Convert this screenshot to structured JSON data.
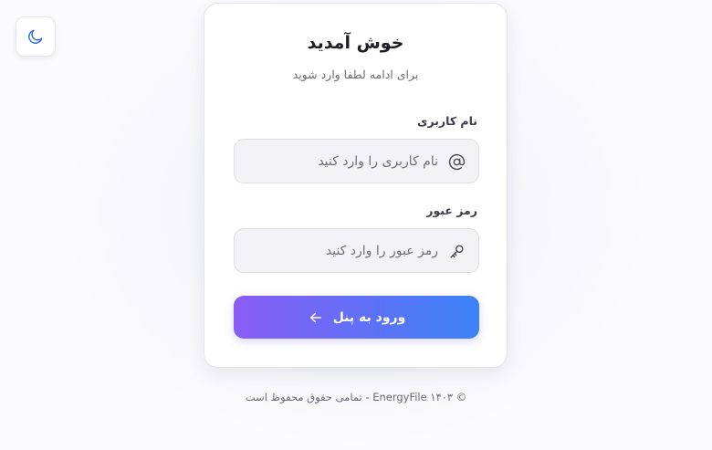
{
  "theme_toggle": {
    "icon": "moon-icon"
  },
  "card": {
    "title": "خوش آمدید",
    "subtitle": "برای ادامه لطفا وارد شوید"
  },
  "form": {
    "username": {
      "label": "نام کاربری",
      "placeholder": "نام کاربری را وارد کنید",
      "value": "",
      "icon": "at-sign-icon"
    },
    "password": {
      "label": "رمز عبور",
      "placeholder": "رمز عبور را وارد کنید",
      "value": "",
      "icon": "key-icon"
    },
    "submit": {
      "label": "ورود به پنل",
      "icon": "arrow-left-icon"
    }
  },
  "footer": {
    "text": "© ۱۴۰۳ EnergyFile - تمامی حقوق محفوظ است"
  },
  "colors": {
    "accent_start": "#8a5cf6",
    "accent_end": "#3b82f6",
    "moon": "#3b6fd8"
  }
}
